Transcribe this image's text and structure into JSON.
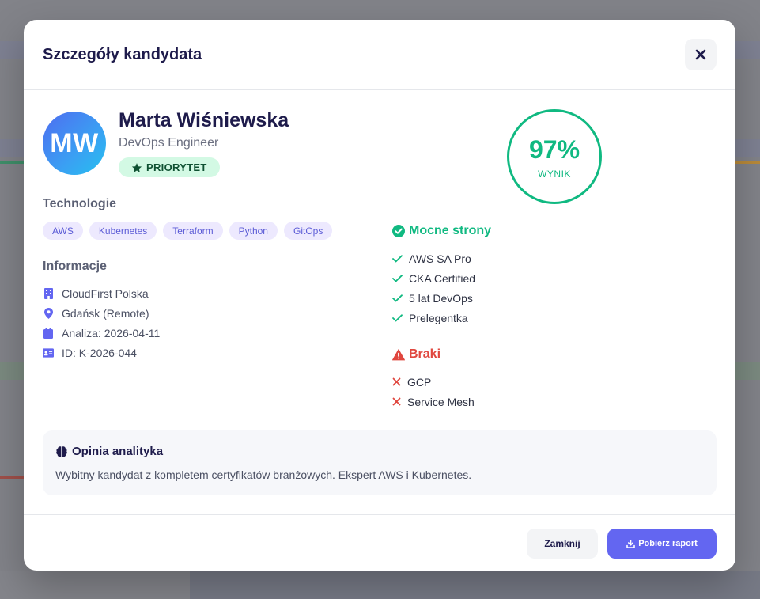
{
  "modal": {
    "title": "Szczegóły kandydata",
    "close_icon": "close-icon"
  },
  "candidate": {
    "initials": "MW",
    "name": "Marta Wiśniewska",
    "role": "DevOps Engineer",
    "badge": "PRIORYTET",
    "badge_icon": "star-icon"
  },
  "score": {
    "value": "97%",
    "label": "WYNIK",
    "color": "#10b981"
  },
  "technologies": {
    "title": "Technologie",
    "tags": [
      "AWS",
      "Kubernetes",
      "Terraform",
      "Python",
      "GitOps"
    ]
  },
  "info": {
    "title": "Informacje",
    "items": [
      {
        "icon": "building-icon",
        "text": "CloudFirst Polska"
      },
      {
        "icon": "map-pin-icon",
        "text": "Gdańsk (Remote)"
      },
      {
        "icon": "calendar-icon",
        "text": "Analiza: 2026-04-11"
      },
      {
        "icon": "id-card-icon",
        "text": "ID: K-2026-044"
      }
    ]
  },
  "strengths": {
    "title": "Mocne strony",
    "icon": "check-circle-icon",
    "items": [
      "AWS SA Pro",
      "CKA Certified",
      "5 lat DevOps",
      "Prelegentka"
    ]
  },
  "gaps": {
    "title": "Braki",
    "icon": "warning-icon",
    "items": [
      "GCP",
      "Service Mesh"
    ]
  },
  "opinion": {
    "title": "Opinia analityka",
    "icon": "brain-icon",
    "text": "Wybitny kandydat z kompletem certyfikatów branżowych. Ekspert AWS i Kubernetes."
  },
  "footer": {
    "close_label": "Zamknij",
    "download_label": "Pobierz raport",
    "download_icon": "download-icon"
  },
  "colors": {
    "accent": "#6366f1",
    "success": "#10b981",
    "danger": "#e0473f"
  }
}
